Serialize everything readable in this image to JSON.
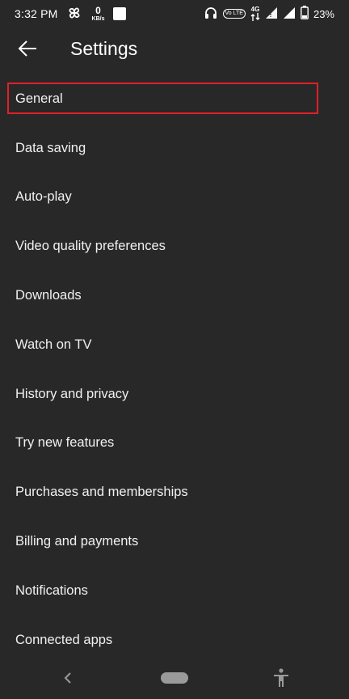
{
  "status_bar": {
    "time": "3:32 PM",
    "net_speed_value": "0",
    "net_speed_unit": "KB/s",
    "network_type": "4G",
    "volte_label": "Vo LTE",
    "battery_percent": "23%",
    "icons": [
      "fan-icon",
      "white-square-icon",
      "headphones-icon",
      "volte-icon",
      "signal-4g-icon",
      "wifi-icon",
      "signal-icon",
      "battery-icon"
    ]
  },
  "header": {
    "title": "Settings",
    "back_icon": "arrow-left-icon"
  },
  "settings": {
    "items": [
      {
        "label": "General",
        "highlighted": true
      },
      {
        "label": "Data saving"
      },
      {
        "label": "Auto-play"
      },
      {
        "label": "Video quality preferences"
      },
      {
        "label": "Downloads"
      },
      {
        "label": "Watch on TV"
      },
      {
        "label": "History and privacy"
      },
      {
        "label": "Try new features"
      },
      {
        "label": "Purchases and memberships"
      },
      {
        "label": "Billing and payments"
      },
      {
        "label": "Notifications"
      },
      {
        "label": "Connected apps"
      }
    ]
  },
  "nav_bar": {
    "icons": [
      "nav-back-icon",
      "nav-home-pill",
      "accessibility-icon"
    ]
  },
  "colors": {
    "background": "#282828",
    "text": "#f1f1f1",
    "highlight_border": "#e0202a"
  }
}
